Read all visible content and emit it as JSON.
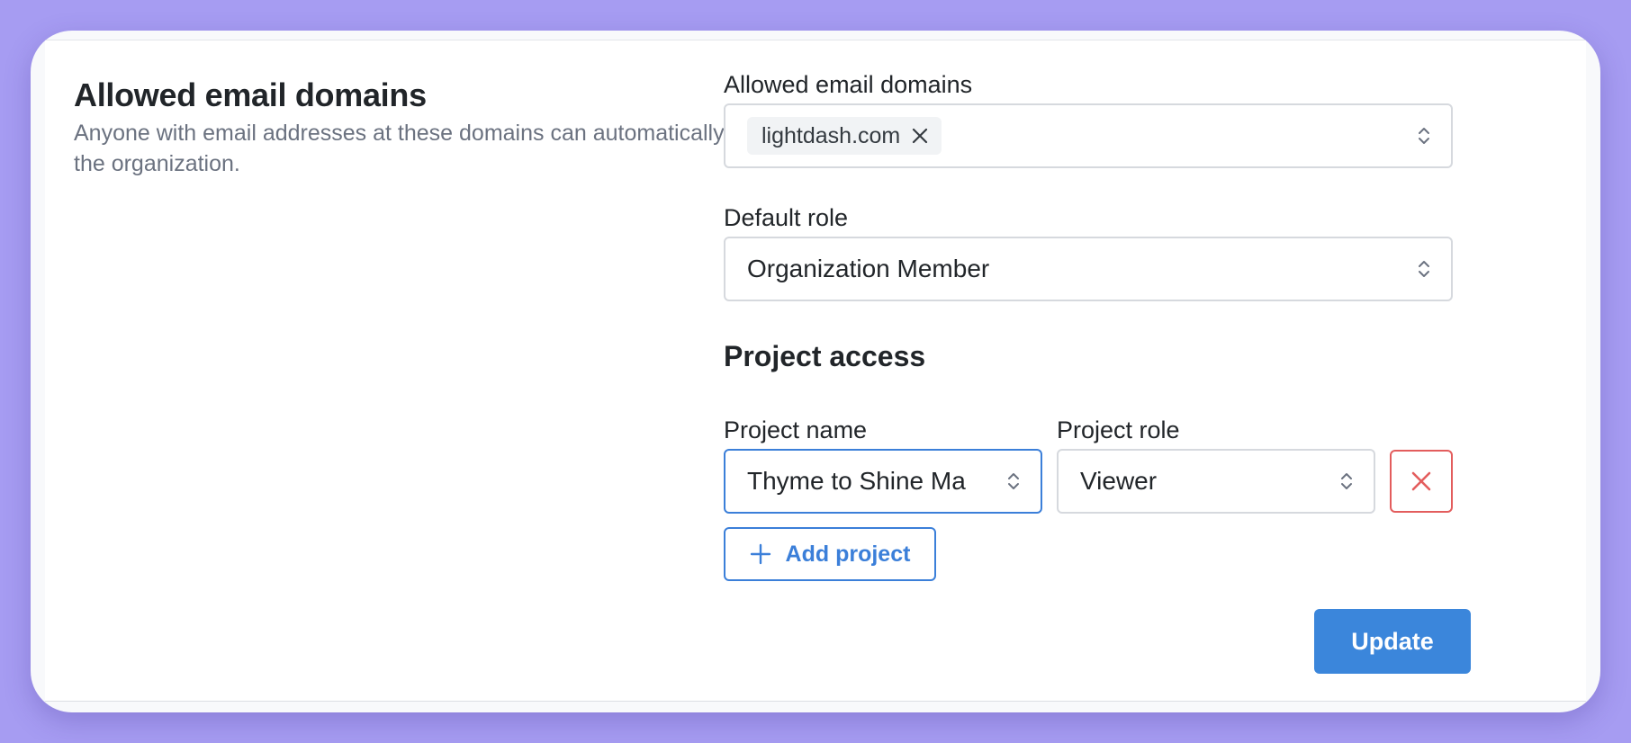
{
  "settings": {
    "section_title": "Allowed email domains",
    "section_description": "Anyone with email addresses at these domains can automatically join the organization."
  },
  "form": {
    "domains_label": "Allowed email domains",
    "domains": [
      "lightdash.com"
    ],
    "default_role_label": "Default role",
    "default_role_value": "Organization Member",
    "project_access_heading": "Project access",
    "project_name_label": "Project name",
    "project_role_label": "Project role",
    "project_rows": [
      {
        "project_name": "Thyme to Shine Ma",
        "project_role": "Viewer"
      }
    ],
    "add_project_label": "Add project",
    "update_label": "Update"
  },
  "icons": {
    "select": "chevron-up-down-icon",
    "tag_remove": "close-icon",
    "row_remove": "close-icon",
    "add": "plus-icon"
  },
  "colors": {
    "background": "#a69cf2",
    "primary": "#3b86db",
    "danger": "#e35d5d",
    "muted_text": "#6b7280"
  }
}
